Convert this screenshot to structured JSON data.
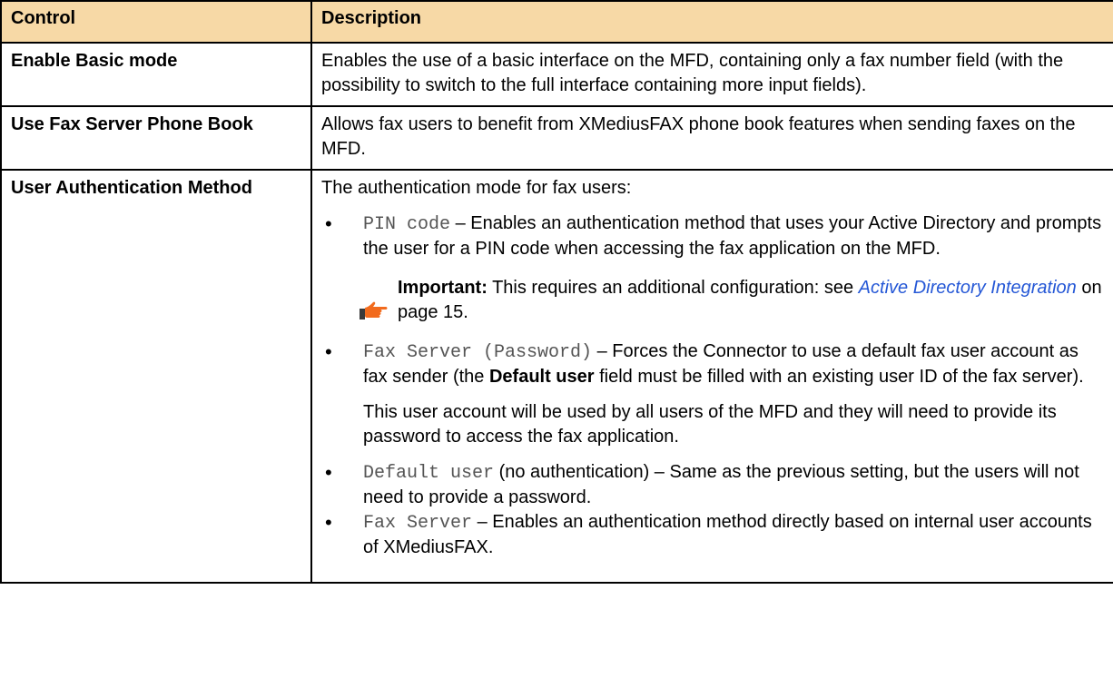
{
  "table": {
    "header": {
      "control": "Control",
      "description": "Description"
    },
    "rows": [
      {
        "control": "Enable Basic mode",
        "description": "Enables the use of a basic interface on the MFD, containing only a fax number field (with the possibility to switch to the full interface containing more input fields)."
      },
      {
        "control": "Use Fax Server Phone Book",
        "description": "Allows fax users to benefit from XMediusFAX phone book features when sending faxes on the MFD."
      },
      {
        "control": "User Authentication Method",
        "intro": "The authentication mode for fax users:",
        "options": [
          {
            "code": "PIN code",
            "text": " – Enables an authentication method that uses your Active Directory and prompts the user for a PIN code when accessing the fax application on the MFD."
          },
          {
            "code": "Fax Server (Password)",
            "text_before": " – Forces the Connector to use a default fax user account as fax sender (the ",
            "bold": "Default user",
            "text_after": " field must be filled with an existing user ID of the fax server).",
            "extra": "This user account will be used by all users of the MFD and they will need to provide its password to access the fax application."
          },
          {
            "code": "Default user",
            "text": " (no authentication) – Same as the previous setting, but the users will not need to provide a password."
          },
          {
            "code": "Fax Server",
            "text": " – Enables an authentication method directly based on internal user accounts of XMediusFAX."
          }
        ],
        "note": {
          "label": "Important:",
          "text": " This requires an additional configuration: see ",
          "link": "Active Directory Integration",
          "suffix": " on page 15."
        }
      }
    ]
  },
  "icons": {
    "note_icon": "pointing-hand-icon",
    "bullet": "•"
  },
  "colors": {
    "header_bg": "#f7d9a6",
    "link": "#2457d6",
    "code": "#555555",
    "hand": "#f26b1d"
  }
}
